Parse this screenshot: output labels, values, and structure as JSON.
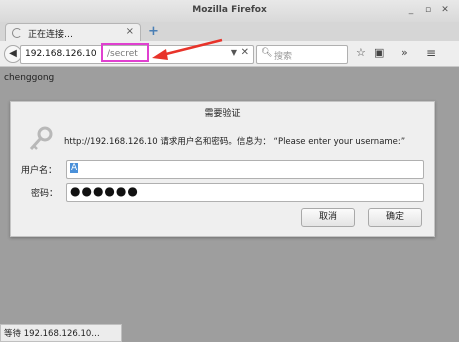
{
  "window": {
    "title": "Mozilla Firefox"
  },
  "tab": {
    "label": "正在连接…"
  },
  "navbar": {
    "url_host": "192.168.126.10",
    "url_path": "/secret",
    "search_placeholder": "搜索"
  },
  "page": {
    "text": "chenggong"
  },
  "dialog": {
    "title": "需要验证",
    "message": "http://192.168.126.10 请求用户名和密码。信息为：  “Please enter your username:”",
    "username_label": "用户名：",
    "username_value": "A",
    "password_label": "密码：",
    "password_value": "●●●●●●",
    "cancel_label": "取消",
    "ok_label": "确定"
  },
  "status": {
    "text": "等待 192.168.126.10…"
  },
  "colors": {
    "highlight": "#e040d0",
    "arrow": "#e8332a"
  }
}
